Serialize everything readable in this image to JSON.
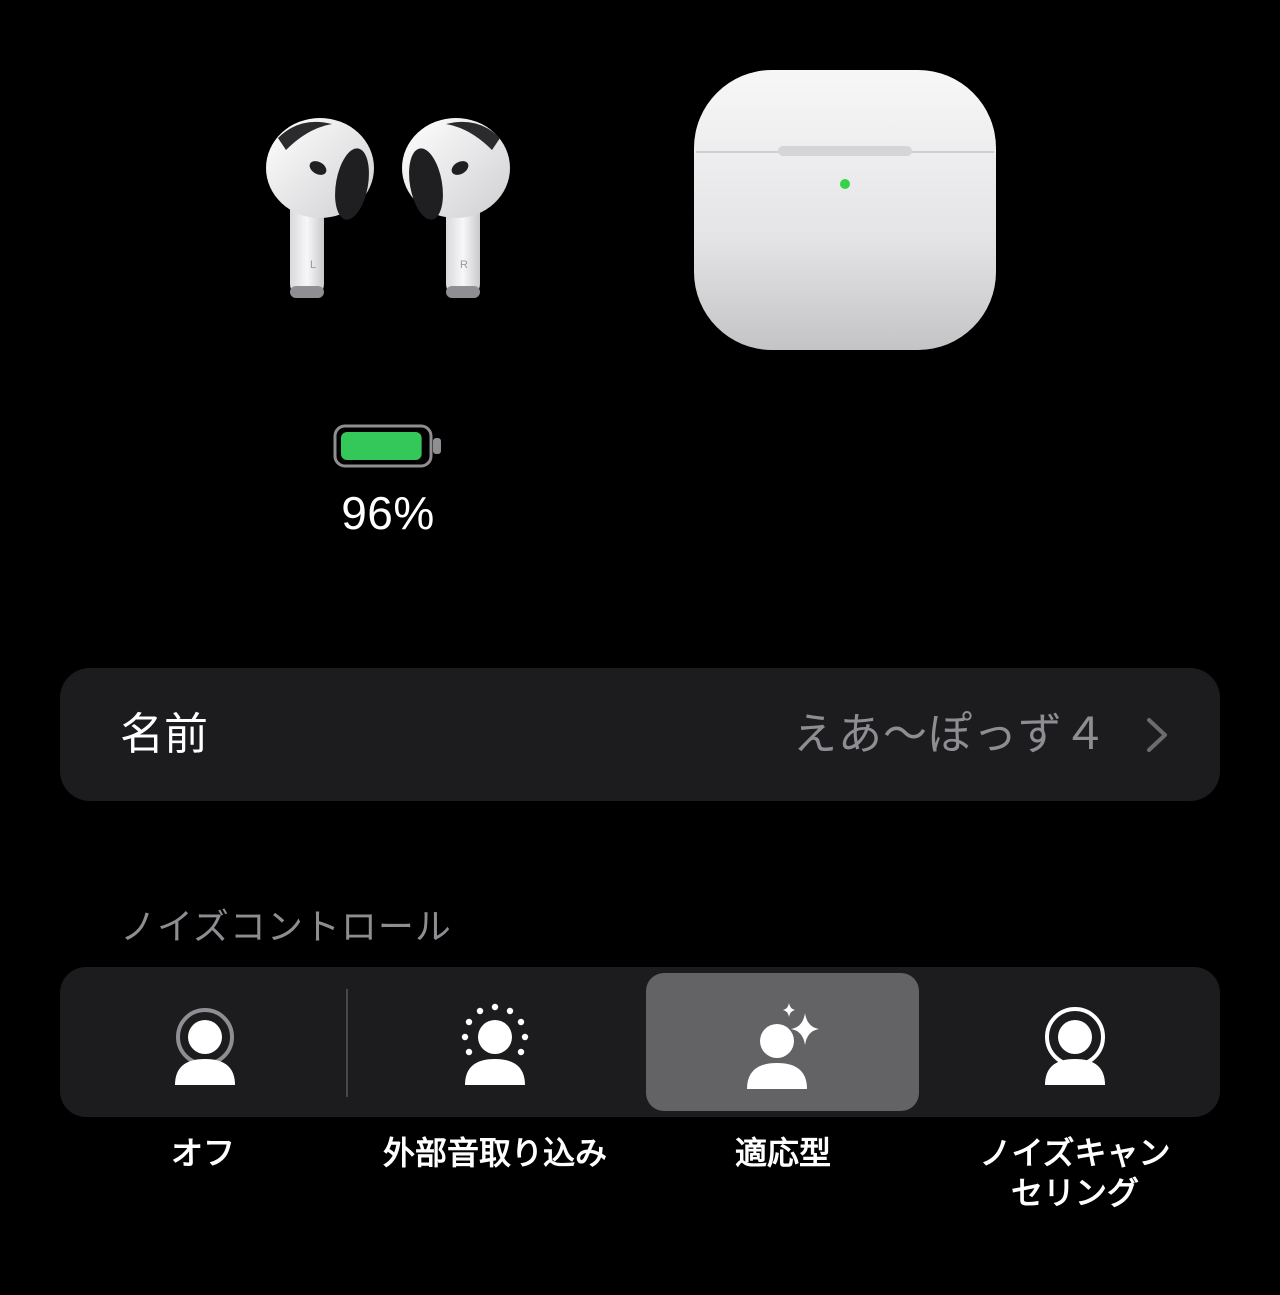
{
  "device": {
    "earbud_left_mark": "L",
    "earbud_right_mark": "R",
    "battery": {
      "level": 0.96,
      "label": "96%",
      "color": "#34c759"
    },
    "case_status_light_color": "#35d34a"
  },
  "name_row": {
    "label": "名前",
    "value": "えあ〜ぽっず４",
    "chevron_icon": "chevron-right-icon"
  },
  "noise_control": {
    "header": "ノイズコントロール",
    "selected": "adaptive",
    "options": [
      {
        "id": "off",
        "label": "オフ",
        "icon": "person-off-icon"
      },
      {
        "id": "transparency",
        "label": "外部音取り込み",
        "icon": "person-transparency-icon"
      },
      {
        "id": "adaptive",
        "label": "適応型",
        "icon": "person-sparkle-icon"
      },
      {
        "id": "noise_cancellation",
        "label_line1": "ノイズキャン",
        "label_line2": "セリング",
        "icon": "person-noise-cancel-icon"
      }
    ]
  },
  "colors": {
    "background": "#000000",
    "card": "#1c1c1e",
    "selected_segment": "#636366",
    "secondary_text": "#8d8d92"
  }
}
